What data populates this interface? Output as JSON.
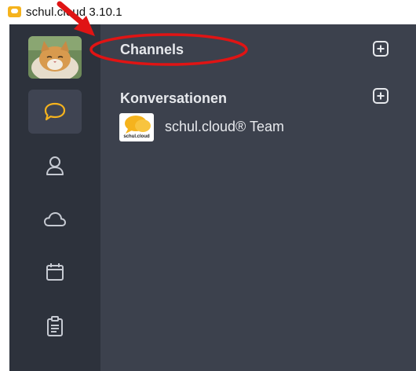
{
  "window": {
    "title": "schul.cloud 3.10.1",
    "app_icon": "speech-bubble-icon"
  },
  "rail": {
    "avatar": "cat-profile-photo",
    "items": [
      {
        "name": "chats",
        "icon": "speech-bubble-icon",
        "active": true
      },
      {
        "name": "contacts",
        "icon": "person-icon",
        "active": false
      },
      {
        "name": "cloud",
        "icon": "cloud-icon",
        "active": false
      },
      {
        "name": "calendar",
        "icon": "calendar-icon",
        "active": false
      },
      {
        "name": "tasks",
        "icon": "clipboard-icon",
        "active": false
      }
    ]
  },
  "main": {
    "channels": {
      "title": "Channels",
      "add_icon": "plus-square-icon"
    },
    "conversations": {
      "title": "Konversationen",
      "add_icon": "plus-square-icon",
      "items": [
        {
          "name": "schul.cloud® Team",
          "avatar_text": "schul.cloud"
        }
      ]
    }
  },
  "colors": {
    "rail_bg": "#2d323c",
    "main_bg": "#3c414d",
    "accent": "#f5b31d",
    "annotation": "#e01414"
  }
}
